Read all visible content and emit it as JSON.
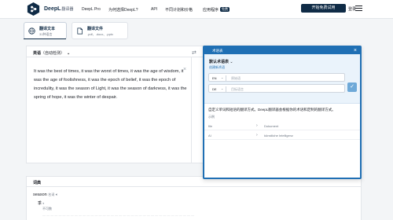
{
  "header": {
    "brand": "DeepL",
    "brand_sub": "翻译器",
    "nav": [
      "DeepL Pro",
      "为何选择DeepL?",
      "API",
      "不同计划和价格",
      "应用程序"
    ],
    "free_badge": "免费",
    "cta": "开始免费试用",
    "login": "登录"
  },
  "modes": [
    {
      "title": "翻译文本",
      "subtitle": "31种语言"
    },
    {
      "title": "翻译文件",
      "subtitle": ".pdf、.docx、.pptx"
    }
  ],
  "translator": {
    "source_lang": "英语",
    "detected": "（自动检测）",
    "source_text": "It was the best of times, it was the worst of times, it was the age of wisdom, it was the age of foolishness, it was the epoch of belief, it was the epoch of incredulity, it was the season of Light, it was the season of darkness, it was the spring of hope, it was the winter of despair."
  },
  "dictionary": {
    "title": "词典",
    "word": "season",
    "pos": "名词",
    "sense": "季",
    "note": "不可数"
  },
  "glossary": {
    "title": "术语表",
    "dropdown": "默认术语表",
    "link": "创建新术语",
    "source_lang": "EN",
    "source_placeholder": "原始语",
    "target_lang": "DE",
    "target_placeholder": "目标语言",
    "description": "自定义单词和短语的翻译方式。DeepL翻译器会根据你的术语和定制的翻译方式。",
    "examples_label": "示例",
    "examples": [
      {
        "source": "file",
        "target": "Dokument"
      },
      {
        "source": "AI",
        "target": "künstliche Intelligenz"
      }
    ]
  },
  "colors": {
    "brand": "#0f2b46",
    "accent": "#1f6fb4",
    "popup_bg": "#eaf3fb",
    "check": "#6ea9d8"
  }
}
